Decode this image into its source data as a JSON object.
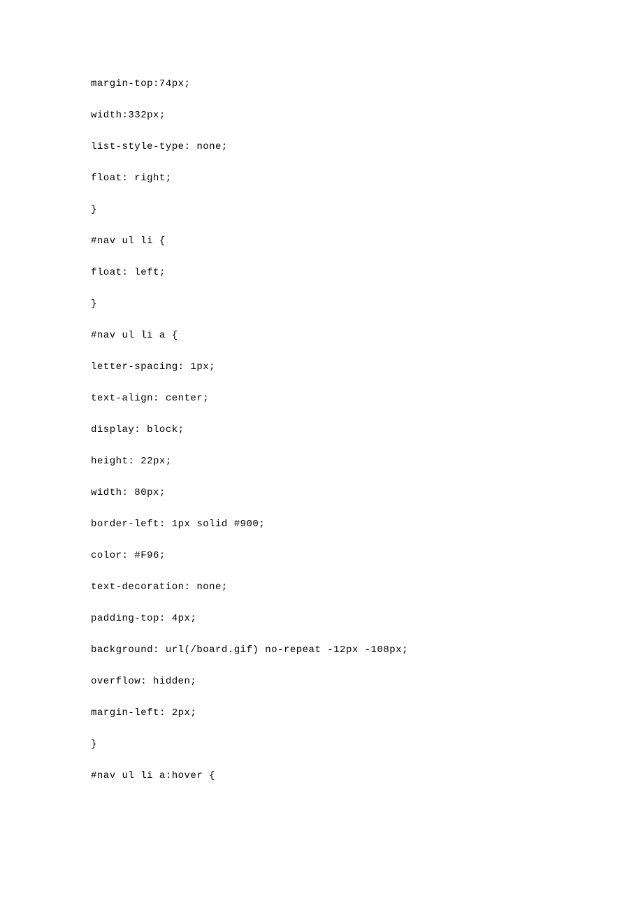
{
  "lines": [
    "margin-top:74px;",
    "width:332px;",
    "list-style-type: none;",
    "float: right;",
    "",
    "}",
    "#nav ul li {",
    "float: left;",
    "}",
    "#nav ul li a {",
    "letter-spacing: 1px;",
    "text-align: center;",
    "display: block;",
    "height: 22px;",
    "width: 80px;",
    "border-left: 1px solid #900;",
    "color: #F96;",
    "text-decoration: none;",
    "padding-top: 4px;",
    "background: url(/board.gif) no-repeat -12px -108px;",
    "overflow: hidden;",
    "margin-left: 2px;",
    "}",
    "#nav ul li a:hover {"
  ]
}
